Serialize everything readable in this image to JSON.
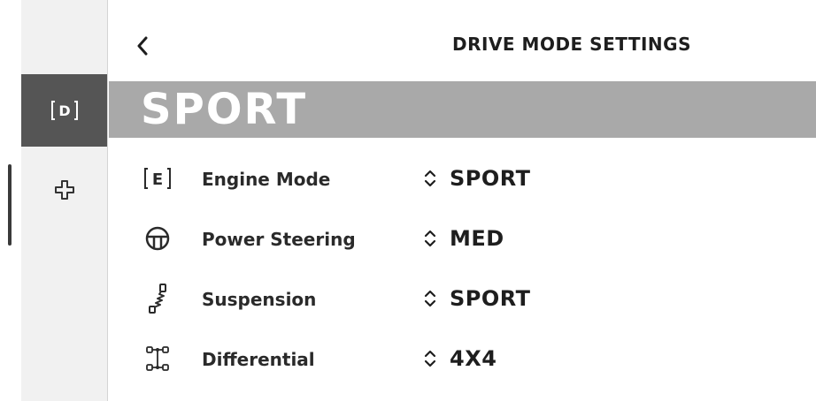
{
  "header": {
    "title": "DRIVE MODE SETTINGS",
    "back_icon": "chevron-left-icon"
  },
  "sidebar": {
    "items": [
      {
        "icon": "drive-mode-icon",
        "label": "[D]",
        "active": true
      },
      {
        "icon": "plus-outline-icon",
        "active": false
      }
    ]
  },
  "mode": {
    "name": "SPORT"
  },
  "settings": [
    {
      "icon": "engine-mode-icon",
      "icon_text": "[E]",
      "label": "Engine Mode",
      "value": "SPORT"
    },
    {
      "icon": "steering-wheel-icon",
      "label": "Power Steering",
      "value": "MED"
    },
    {
      "icon": "suspension-icon",
      "label": "Suspension",
      "value": "SPORT"
    },
    {
      "icon": "differential-icon",
      "label": "Differential",
      "value": "4X4"
    }
  ],
  "colors": {
    "banner": "#a9a9a9",
    "active_sidebar": "#555555",
    "text": "#1e1e1e"
  }
}
